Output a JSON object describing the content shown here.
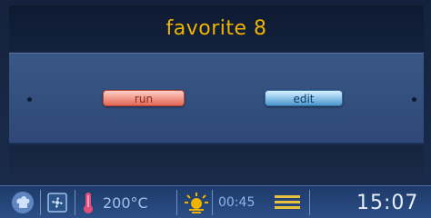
{
  "screen": {
    "title": "favorite 8"
  },
  "actions": {
    "run_label": "run",
    "edit_label": "edit"
  },
  "status": {
    "temperature": "200°C",
    "duration": "00:45",
    "clock": "15:07"
  },
  "icons": {
    "chef": "chef-hat-icon",
    "fan": "fan-icon",
    "thermometer": "thermometer-icon",
    "heat": "sun-heat-icon",
    "bars": "bars-icon"
  },
  "colors": {
    "title": "#f0b400",
    "run_button": "#f3a092",
    "edit_button": "#8fc6ea",
    "thermometer": "#e0507c",
    "heat_icon": "#f0b400",
    "bars": "#e8c23a"
  }
}
